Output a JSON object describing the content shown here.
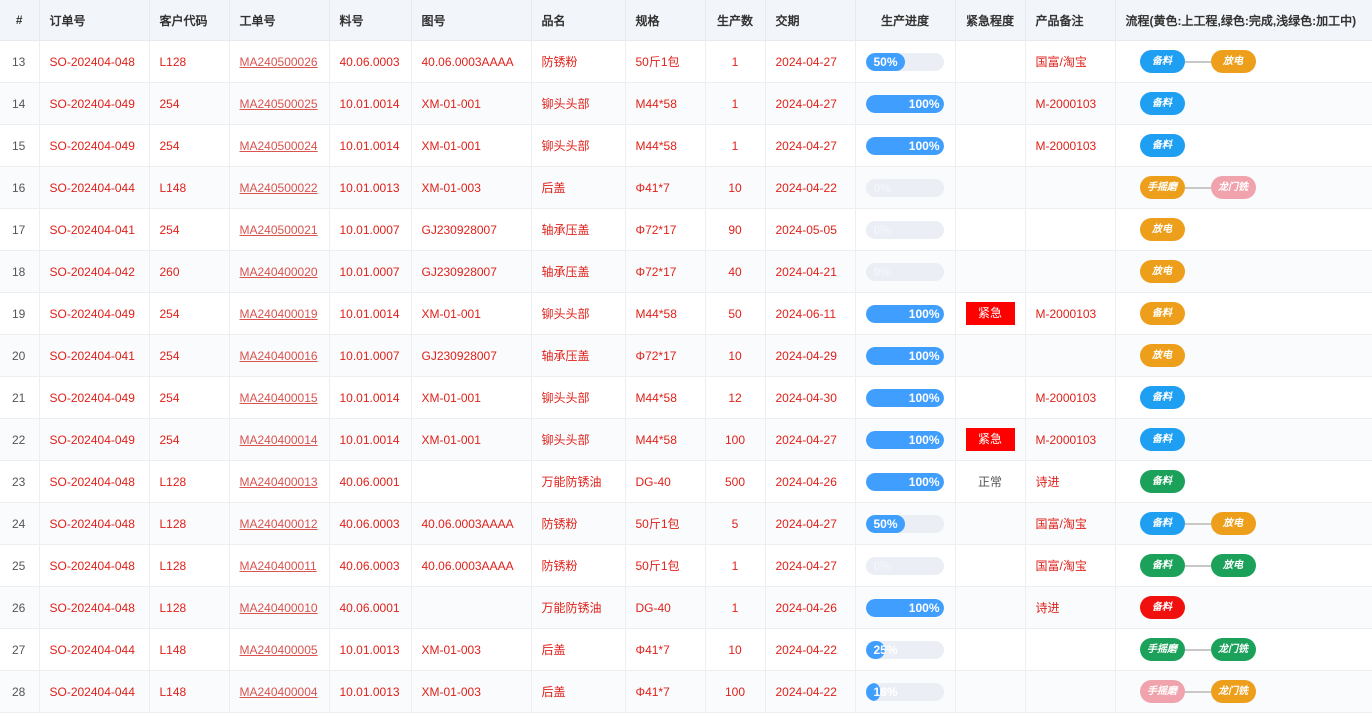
{
  "colors": {
    "blue": "#1e9ff2",
    "yellow": "#ed9f1b",
    "green": "#1ba15a",
    "pink": "#f0a3ac",
    "red": "#f0110f"
  },
  "headers": [
    "#",
    "订单号",
    "客户代码",
    "工单号",
    "料号",
    "图号",
    "品名",
    "规格",
    "生产数",
    "交期",
    "生产进度",
    "紧急程度",
    "产品备注",
    "流程(黄色:上工程,绿色:完成,浅绿色:加工中)"
  ],
  "rows": [
    {
      "no": "13",
      "order": "SO-202404-048",
      "cust": "L128",
      "wo": "MA240500026",
      "part": "40.06.0003",
      "drawing": "40.06.0003AAAA",
      "name": "防锈粉",
      "spec": "50斤1包",
      "qty": "1",
      "due": "2024-04-27",
      "progress": 50,
      "progress_label": "50%",
      "urgency": "",
      "remark": "国富/淘宝",
      "flow": [
        {
          "label": "备料",
          "color": "blue"
        },
        {
          "label": "放电",
          "color": "yellow"
        }
      ]
    },
    {
      "no": "14",
      "order": "SO-202404-049",
      "cust": "254",
      "wo": "MA240500025",
      "part": "10.01.0014",
      "drawing": "XM-01-001",
      "name": "铆头头部",
      "spec": "M44*58",
      "qty": "1",
      "due": "2024-04-27",
      "progress": 100,
      "progress_label": "100%",
      "urgency": "",
      "remark": "M-2000103",
      "flow": [
        {
          "label": "备料",
          "color": "blue"
        }
      ]
    },
    {
      "no": "15",
      "order": "SO-202404-049",
      "cust": "254",
      "wo": "MA240500024",
      "part": "10.01.0014",
      "drawing": "XM-01-001",
      "name": "铆头头部",
      "spec": "M44*58",
      "qty": "1",
      "due": "2024-04-27",
      "progress": 100,
      "progress_label": "100%",
      "urgency": "",
      "remark": "M-2000103",
      "flow": [
        {
          "label": "备料",
          "color": "blue"
        }
      ]
    },
    {
      "no": "16",
      "order": "SO-202404-044",
      "cust": "L148",
      "wo": "MA240500022",
      "part": "10.01.0013",
      "drawing": "XM-01-003",
      "name": "后盖",
      "spec": "Φ41*7",
      "qty": "10",
      "due": "2024-04-22",
      "progress": 0,
      "progress_label": "0%",
      "urgency": "",
      "remark": "",
      "flow": [
        {
          "label": "手摇磨",
          "color": "yellow"
        },
        {
          "label": "龙门铣",
          "color": "pink"
        }
      ]
    },
    {
      "no": "17",
      "order": "SO-202404-041",
      "cust": "254",
      "wo": "MA240500021",
      "part": "10.01.0007",
      "drawing": "GJ230928007",
      "name": "轴承压盖",
      "spec": "Φ72*17",
      "qty": "90",
      "due": "2024-05-05",
      "progress": 0,
      "progress_label": "0%",
      "urgency": "",
      "remark": "",
      "flow": [
        {
          "label": "放电",
          "color": "yellow"
        }
      ]
    },
    {
      "no": "18",
      "order": "SO-202404-042",
      "cust": "260",
      "wo": "MA240400020",
      "part": "10.01.0007",
      "drawing": "GJ230928007",
      "name": "轴承压盖",
      "spec": "Φ72*17",
      "qty": "40",
      "due": "2024-04-21",
      "progress": 0,
      "progress_label": "0%",
      "urgency": "",
      "remark": "",
      "flow": [
        {
          "label": "放电",
          "color": "yellow"
        }
      ]
    },
    {
      "no": "19",
      "order": "SO-202404-049",
      "cust": "254",
      "wo": "MA240400019",
      "part": "10.01.0014",
      "drawing": "XM-01-001",
      "name": "铆头头部",
      "spec": "M44*58",
      "qty": "50",
      "due": "2024-06-11",
      "progress": 100,
      "progress_label": "100%",
      "urgency": "紧急",
      "remark": "M-2000103",
      "flow": [
        {
          "label": "备料",
          "color": "yellow"
        }
      ]
    },
    {
      "no": "20",
      "order": "SO-202404-041",
      "cust": "254",
      "wo": "MA240400016",
      "part": "10.01.0007",
      "drawing": "GJ230928007",
      "name": "轴承压盖",
      "spec": "Φ72*17",
      "qty": "10",
      "due": "2024-04-29",
      "progress": 100,
      "progress_label": "100%",
      "urgency": "",
      "remark": "",
      "flow": [
        {
          "label": "放电",
          "color": "yellow"
        }
      ]
    },
    {
      "no": "21",
      "order": "SO-202404-049",
      "cust": "254",
      "wo": "MA240400015",
      "part": "10.01.0014",
      "drawing": "XM-01-001",
      "name": "铆头头部",
      "spec": "M44*58",
      "qty": "12",
      "due": "2024-04-30",
      "progress": 100,
      "progress_label": "100%",
      "urgency": "",
      "remark": "M-2000103",
      "flow": [
        {
          "label": "备料",
          "color": "blue"
        }
      ]
    },
    {
      "no": "22",
      "order": "SO-202404-049",
      "cust": "254",
      "wo": "MA240400014",
      "part": "10.01.0014",
      "drawing": "XM-01-001",
      "name": "铆头头部",
      "spec": "M44*58",
      "qty": "100",
      "due": "2024-04-27",
      "progress": 100,
      "progress_label": "100%",
      "urgency": "紧急",
      "remark": "M-2000103",
      "flow": [
        {
          "label": "备料",
          "color": "blue"
        }
      ]
    },
    {
      "no": "23",
      "order": "SO-202404-048",
      "cust": "L128",
      "wo": "MA240400013",
      "part": "40.06.0001",
      "drawing": "",
      "name": "万能防锈油",
      "spec": "DG-40",
      "qty": "500",
      "due": "2024-04-26",
      "progress": 100,
      "progress_label": "100%",
      "urgency": "正常",
      "remark": "诗进",
      "flow": [
        {
          "label": "备料",
          "color": "green"
        }
      ]
    },
    {
      "no": "24",
      "order": "SO-202404-048",
      "cust": "L128",
      "wo": "MA240400012",
      "part": "40.06.0003",
      "drawing": "40.06.0003AAAA",
      "name": "防锈粉",
      "spec": "50斤1包",
      "qty": "5",
      "due": "2024-04-27",
      "progress": 50,
      "progress_label": "50%",
      "urgency": "",
      "remark": "国富/淘宝",
      "flow": [
        {
          "label": "备料",
          "color": "blue"
        },
        {
          "label": "放电",
          "color": "yellow"
        }
      ]
    },
    {
      "no": "25",
      "order": "SO-202404-048",
      "cust": "L128",
      "wo": "MA240400011",
      "part": "40.06.0003",
      "drawing": "40.06.0003AAAA",
      "name": "防锈粉",
      "spec": "50斤1包",
      "qty": "1",
      "due": "2024-04-27",
      "progress": 0,
      "progress_label": "0%",
      "urgency": "",
      "remark": "国富/淘宝",
      "flow": [
        {
          "label": "备料",
          "color": "green"
        },
        {
          "label": "放电",
          "color": "green"
        }
      ]
    },
    {
      "no": "26",
      "order": "SO-202404-048",
      "cust": "L128",
      "wo": "MA240400010",
      "part": "40.06.0001",
      "drawing": "",
      "name": "万能防锈油",
      "spec": "DG-40",
      "qty": "1",
      "due": "2024-04-26",
      "progress": 100,
      "progress_label": "100%",
      "urgency": "",
      "remark": "诗进",
      "flow": [
        {
          "label": "备料",
          "color": "red"
        }
      ]
    },
    {
      "no": "27",
      "order": "SO-202404-044",
      "cust": "L148",
      "wo": "MA240400005",
      "part": "10.01.0013",
      "drawing": "XM-01-003",
      "name": "后盖",
      "spec": "Φ41*7",
      "qty": "10",
      "due": "2024-04-22",
      "progress": 25,
      "progress_label": "25%",
      "urgency": "",
      "remark": "",
      "flow": [
        {
          "label": "手摇磨",
          "color": "green"
        },
        {
          "label": "龙门铣",
          "color": "green"
        }
      ]
    },
    {
      "no": "28",
      "order": "SO-202404-044",
      "cust": "L148",
      "wo": "MA240400004",
      "part": "10.01.0013",
      "drawing": "XM-01-003",
      "name": "后盖",
      "spec": "Φ41*7",
      "qty": "100",
      "due": "2024-04-22",
      "progress": 18,
      "progress_label": "18%",
      "urgency": "",
      "remark": "",
      "flow": [
        {
          "label": "手摇磨",
          "color": "pink"
        },
        {
          "label": "龙门铣",
          "color": "yellow"
        }
      ]
    }
  ]
}
